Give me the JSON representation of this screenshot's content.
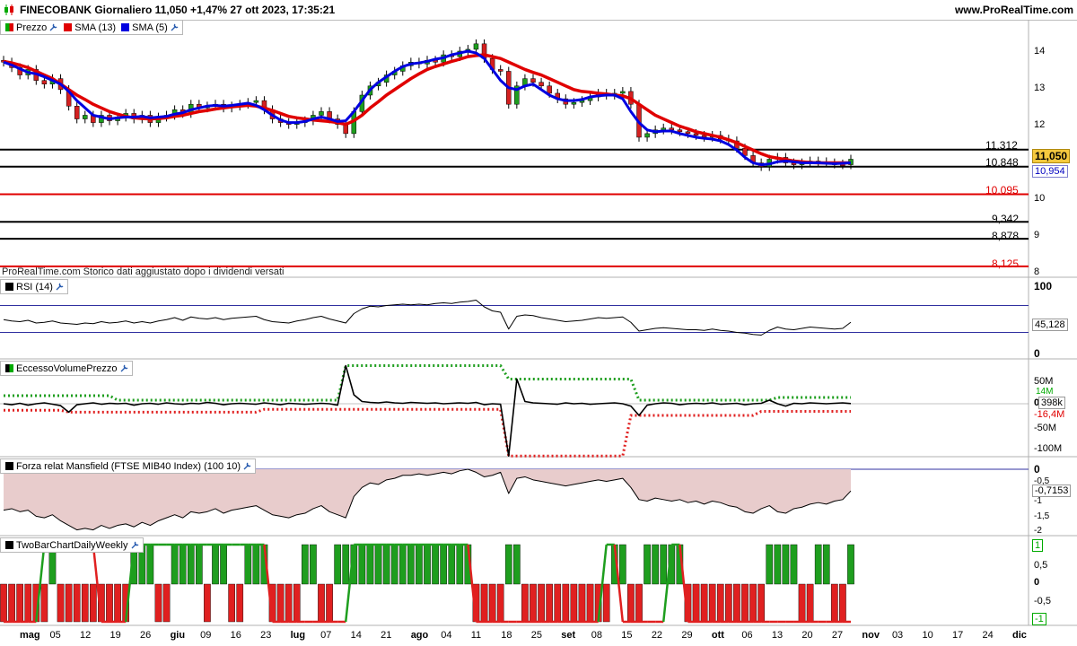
{
  "header": {
    "logo_icon": "candlestick-icon",
    "title": "FINECOBANK Giornaliero 11,050 +1,47% 27 ott 2023, 17:35:21",
    "site": "www.ProRealTime.com"
  },
  "price_panel": {
    "legend": {
      "label": "Prezzo",
      "icon": "wrench-icon"
    },
    "sma13": {
      "label": "SMA (13)",
      "color": "#e00000"
    },
    "sma5": {
      "label": "SMA (5)",
      "color": "#0000e0"
    },
    "note": "ProRealTime.com  Storico dati aggiustato dopo i dividendi versati",
    "y_ticks": [
      "14",
      "13",
      "12",
      "10",
      "9",
      "8"
    ],
    "levels": [
      {
        "value": "11,312",
        "color": "#000000"
      },
      {
        "value": "10,848",
        "color": "#000000"
      },
      {
        "value": "10,095",
        "color": "#e00000"
      },
      {
        "value": "9,342",
        "color": "#000000"
      },
      {
        "value": "8,878",
        "color": "#000000"
      },
      {
        "value": "8,125",
        "color": "#e00000"
      }
    ],
    "last_price": "11,050",
    "sma_badge": "10,954"
  },
  "rsi_panel": {
    "legend": "RSI (14)",
    "y_ticks": [
      "100",
      "0"
    ],
    "value": "45,128"
  },
  "volume_panel": {
    "legend": "EccessoVolumePrezzo",
    "y_ticks": [
      "50M",
      "0",
      "-50M",
      "-100M"
    ],
    "badge_upper": "14M",
    "badge_value": "398k",
    "badge_lower": "-16,4M"
  },
  "mansfield_panel": {
    "legend": "Forza relat Mansfield (FTSE MIB40 Index) (100 10)",
    "y_ticks": [
      "0",
      "-0,5",
      "-1",
      "-1,5",
      "-2"
    ],
    "value": "-0,7153"
  },
  "twobar_panel": {
    "legend": "TwoBarChartDailyWeekly",
    "y_ticks": [
      "0,5",
      "0",
      "-0,5"
    ],
    "badge_top": "1",
    "badge_bottom": "-1"
  },
  "x_axis": {
    "labels": [
      {
        "text": "mag",
        "bold": true
      },
      {
        "text": "05"
      },
      {
        "text": "12"
      },
      {
        "text": "19"
      },
      {
        "text": "26"
      },
      {
        "text": "giu",
        "bold": true
      },
      {
        "text": "09"
      },
      {
        "text": "16"
      },
      {
        "text": "23"
      },
      {
        "text": "lug",
        "bold": true
      },
      {
        "text": "07"
      },
      {
        "text": "14"
      },
      {
        "text": "21"
      },
      {
        "text": "ago",
        "bold": true
      },
      {
        "text": "04"
      },
      {
        "text": "11"
      },
      {
        "text": "18"
      },
      {
        "text": "25"
      },
      {
        "text": "set",
        "bold": true
      },
      {
        "text": "08"
      },
      {
        "text": "15"
      },
      {
        "text": "22"
      },
      {
        "text": "29"
      },
      {
        "text": "ott",
        "bold": true
      },
      {
        "text": "06"
      },
      {
        "text": "13"
      },
      {
        "text": "20"
      },
      {
        "text": "27"
      },
      {
        "text": "nov",
        "bold": true
      },
      {
        "text": "03"
      },
      {
        "text": "10"
      },
      {
        "text": "17"
      },
      {
        "text": "24"
      },
      {
        "text": "dic",
        "bold": true
      }
    ]
  },
  "chart_data": {
    "type": "line",
    "title": "FINECOBANK Giornaliero 11,050 +1,47% 27 ott 2023, 17:35:21",
    "x_range": [
      "2023-05-01",
      "2023-12-01"
    ],
    "price": {
      "ylim": [
        8,
        14.5
      ],
      "close": [
        13.7,
        13.55,
        13.35,
        13.5,
        13.2,
        13.1,
        13.25,
        12.95,
        12.5,
        12.15,
        12.25,
        12.05,
        12.25,
        12.1,
        12.2,
        12.3,
        12.15,
        12.25,
        12.05,
        12.2,
        12.25,
        12.4,
        12.3,
        12.55,
        12.45,
        12.5,
        12.55,
        12.45,
        12.5,
        12.55,
        12.6,
        12.65,
        12.4,
        12.15,
        12.05,
        12.0,
        12.05,
        12.1,
        12.25,
        12.35,
        12.15,
        12.0,
        11.75,
        12.35,
        12.8,
        13.05,
        13.15,
        13.35,
        13.45,
        13.6,
        13.7,
        13.65,
        13.75,
        13.7,
        13.9,
        13.85,
        14.0,
        14.05,
        14.2,
        13.8,
        13.5,
        13.45,
        12.55,
        13.05,
        13.25,
        13.15,
        13.05,
        12.85,
        12.7,
        12.55,
        12.6,
        12.65,
        12.75,
        12.85,
        12.8,
        12.85,
        12.9,
        12.55,
        11.65,
        11.75,
        11.85,
        11.9,
        11.85,
        11.8,
        11.75,
        11.7,
        11.65,
        11.7,
        11.6,
        11.55,
        11.35,
        11.15,
        10.95,
        10.85,
        11.05,
        11.1,
        10.95,
        10.9,
        10.95,
        11.0,
        10.98,
        10.95,
        10.92,
        10.9,
        11.05
      ],
      "sma13": [
        13.72,
        13.68,
        13.62,
        13.55,
        13.45,
        13.35,
        13.25,
        13.1,
        12.95,
        12.8,
        12.68,
        12.55,
        12.45,
        12.35,
        12.28,
        12.22,
        12.18,
        12.16,
        12.15,
        12.16,
        12.18,
        12.22,
        12.25,
        12.3,
        12.35,
        12.38,
        12.42,
        12.45,
        12.48,
        12.5,
        12.52,
        12.5,
        12.45,
        12.38,
        12.3,
        12.22,
        12.18,
        12.15,
        12.12,
        12.1,
        12.08,
        12.05,
        12.0,
        12.1,
        12.25,
        12.45,
        12.62,
        12.8,
        12.95,
        13.1,
        13.25,
        13.38,
        13.5,
        13.58,
        13.65,
        13.72,
        13.78,
        13.85,
        13.88,
        13.9,
        13.85,
        13.8,
        13.7,
        13.6,
        13.5,
        13.42,
        13.35,
        13.25,
        13.15,
        13.05,
        12.95,
        12.9,
        12.88,
        12.85,
        12.83,
        12.8,
        12.78,
        12.7,
        12.55,
        12.4,
        12.25,
        12.15,
        12.05,
        11.95,
        11.88,
        11.8,
        11.75,
        11.7,
        11.65,
        11.58,
        11.5,
        11.4,
        11.3,
        11.2,
        11.12,
        11.08,
        11.04,
        11.0,
        10.98,
        10.96,
        10.95,
        10.95,
        10.95,
        10.95,
        10.95
      ],
      "sma5": [
        13.7,
        13.62,
        13.52,
        13.42,
        13.38,
        13.3,
        13.2,
        13.1,
        12.9,
        12.65,
        12.45,
        12.25,
        12.2,
        12.15,
        12.18,
        12.2,
        12.2,
        12.22,
        12.18,
        12.2,
        12.22,
        12.28,
        12.32,
        12.4,
        12.45,
        12.5,
        12.52,
        12.5,
        12.52,
        12.55,
        12.58,
        12.52,
        12.4,
        12.25,
        12.12,
        12.05,
        12.05,
        12.08,
        12.15,
        12.2,
        12.15,
        12.08,
        12.1,
        12.35,
        12.65,
        12.95,
        13.15,
        13.3,
        13.45,
        13.58,
        13.65,
        13.68,
        13.72,
        13.78,
        13.82,
        13.9,
        13.95,
        14.0,
        13.95,
        13.8,
        13.5,
        13.2,
        13.0,
        12.95,
        13.05,
        13.1,
        12.95,
        12.8,
        12.7,
        12.65,
        12.65,
        12.68,
        12.75,
        12.78,
        12.8,
        12.8,
        12.7,
        12.35,
        12.05,
        11.85,
        11.8,
        11.82,
        11.82,
        11.75,
        11.7,
        11.65,
        11.62,
        11.6,
        11.55,
        11.45,
        11.3,
        11.1,
        10.95,
        10.9,
        10.92,
        10.98,
        11.0,
        10.98,
        10.95,
        10.95,
        10.95,
        10.94,
        10.93,
        10.94,
        10.954
      ],
      "levels": [
        11.312,
        10.848,
        10.095,
        9.342,
        8.878,
        8.125
      ]
    },
    "rsi": {
      "ylim": [
        0,
        100
      ],
      "bands": [
        70,
        30
      ],
      "values": [
        49,
        47,
        46,
        48,
        44,
        45,
        47,
        44,
        43,
        42,
        44,
        43,
        46,
        44,
        45,
        47,
        44,
        46,
        44,
        47,
        49,
        52,
        48,
        53,
        51,
        50,
        52,
        49,
        51,
        52,
        53,
        54,
        49,
        46,
        45,
        44,
        47,
        49,
        52,
        54,
        50,
        47,
        44,
        58,
        65,
        69,
        68,
        70,
        71,
        72,
        71,
        72,
        71,
        73,
        74,
        73,
        75,
        76,
        78,
        68,
        62,
        60,
        35,
        54,
        56,
        55,
        52,
        50,
        48,
        46,
        47,
        48,
        50,
        52,
        51,
        52,
        53,
        45,
        32,
        34,
        36,
        37,
        36,
        35,
        34,
        34,
        33,
        35,
        33,
        32,
        30,
        29,
        27,
        26,
        33,
        38,
        35,
        34,
        36,
        38,
        37,
        36,
        35,
        36,
        45.128
      ]
    },
    "volume_excess": {
      "ylim": [
        -110,
        60
      ],
      "unit": "M",
      "values": [
        0,
        -2,
        1,
        -3,
        0,
        2,
        -1,
        -4,
        -18,
        -2,
        0,
        2,
        -1,
        1,
        0,
        1,
        -3,
        0,
        1,
        -1,
        2,
        0,
        -1,
        1,
        0,
        3,
        1,
        -2,
        0,
        1,
        0,
        -1,
        2,
        0,
        -2,
        1,
        0,
        -1,
        0,
        1,
        0,
        -3,
        85,
        20,
        5,
        3,
        2,
        4,
        2,
        1,
        3,
        2,
        1,
        2,
        0,
        1,
        2,
        1,
        3,
        -2,
        0,
        -1,
        -112,
        55,
        5,
        2,
        1,
        0,
        -1,
        2,
        0,
        1,
        -1,
        0,
        1,
        2,
        0,
        -5,
        -25,
        -3,
        0,
        2,
        1,
        -2,
        0,
        1,
        0,
        2,
        -1,
        0,
        1,
        -2,
        0,
        1,
        8,
        0,
        -5,
        1,
        0,
        2,
        1,
        0,
        1,
        2,
        0.398
      ],
      "upper_band": [
        18,
        18,
        18,
        18,
        18,
        18,
        18,
        18,
        18,
        18,
        18,
        18,
        18,
        18,
        8,
        8,
        8,
        8,
        8,
        8,
        8,
        8,
        8,
        8,
        8,
        8,
        8,
        8,
        8,
        8,
        8,
        8,
        8,
        8,
        8,
        8,
        8,
        8,
        8,
        8,
        8,
        8,
        85,
        85,
        85,
        85,
        85,
        85,
        85,
        85,
        85,
        85,
        85,
        85,
        85,
        85,
        85,
        85,
        85,
        85,
        85,
        85,
        55,
        55,
        55,
        55,
        55,
        55,
        55,
        55,
        55,
        55,
        55,
        55,
        55,
        55,
        55,
        55,
        8,
        8,
        8,
        8,
        8,
        8,
        8,
        8,
        8,
        8,
        8,
        8,
        8,
        8,
        8,
        8,
        8,
        14,
        14,
        14,
        14,
        14,
        14,
        14,
        14,
        14,
        14
      ],
      "lower_band": [
        -14,
        -14,
        -14,
        -14,
        -14,
        -14,
        -14,
        -14,
        -18,
        -18,
        -18,
        -18,
        -18,
        -18,
        -18,
        -18,
        -18,
        -18,
        -18,
        -18,
        -18,
        -18,
        -18,
        -18,
        -18,
        -18,
        -18,
        -18,
        -18,
        -18,
        -18,
        -18,
        -12,
        -12,
        -12,
        -12,
        -12,
        -12,
        -12,
        -12,
        -12,
        -12,
        -12,
        -12,
        -12,
        -12,
        -12,
        -12,
        -12,
        -12,
        -12,
        -12,
        -12,
        -12,
        -12,
        -12,
        -12,
        -12,
        -12,
        -12,
        -12,
        -12,
        -112,
        -112,
        -112,
        -112,
        -112,
        -112,
        -112,
        -112,
        -112,
        -112,
        -112,
        -112,
        -112,
        -112,
        -112,
        -25,
        -25,
        -25,
        -25,
        -25,
        -25,
        -25,
        -25,
        -25,
        -25,
        -25,
        -25,
        -25,
        -25,
        -25,
        -25,
        -16.4,
        -16.4,
        -16.4,
        -16.4,
        -16.4,
        -16.4,
        -16.4,
        -16.4,
        -16.4,
        -16.4,
        -16.4,
        -16.4
      ]
    },
    "mansfield": {
      "ylim": [
        -2.2,
        0.1
      ],
      "values": [
        -1.35,
        -1.3,
        -1.4,
        -1.35,
        -1.55,
        -1.6,
        -1.5,
        -1.7,
        -1.85,
        -2.0,
        -1.95,
        -2.0,
        -1.85,
        -1.95,
        -1.85,
        -1.8,
        -1.9,
        -1.75,
        -1.85,
        -1.7,
        -1.6,
        -1.5,
        -1.6,
        -1.4,
        -1.45,
        -1.4,
        -1.3,
        -1.45,
        -1.35,
        -1.3,
        -1.25,
        -1.2,
        -1.35,
        -1.5,
        -1.55,
        -1.6,
        -1.5,
        -1.45,
        -1.3,
        -1.2,
        -1.4,
        -1.5,
        -1.6,
        -0.9,
        -0.6,
        -0.45,
        -0.5,
        -0.35,
        -0.3,
        -0.2,
        -0.2,
        -0.15,
        -0.2,
        -0.15,
        -0.1,
        -0.15,
        -0.05,
        0,
        -0.1,
        -0.25,
        -0.2,
        -0.1,
        -0.8,
        -0.3,
        -0.25,
        -0.35,
        -0.4,
        -0.45,
        -0.5,
        -0.55,
        -0.5,
        -0.45,
        -0.4,
        -0.35,
        -0.4,
        -0.35,
        -0.3,
        -0.6,
        -1.0,
        -1.05,
        -0.95,
        -1.0,
        -1.05,
        -1.0,
        -1.1,
        -1.05,
        -1.15,
        -1.05,
        -1.1,
        -1.2,
        -1.25,
        -1.4,
        -1.45,
        -1.3,
        -1.2,
        -1.4,
        -1.45,
        -1.3,
        -1.25,
        -1.15,
        -1.1,
        -1.15,
        -1.05,
        -1.0,
        -0.7153
      ]
    },
    "twobar": {
      "ylim": [
        -1,
        1
      ],
      "values": [
        -1,
        -1,
        -1,
        -1,
        -1,
        -1,
        1,
        -1,
        -1,
        -1,
        -1,
        -1,
        -1,
        -1,
        -1,
        -1,
        1,
        1,
        1,
        -1,
        -1,
        1,
        1,
        1,
        1,
        -1,
        1,
        1,
        -1,
        -1,
        1,
        1,
        1,
        -1,
        -1,
        -1,
        -1,
        1,
        1,
        -1,
        -1,
        1,
        1,
        1,
        1,
        1,
        1,
        1,
        1,
        1,
        1,
        1,
        1,
        1,
        1,
        1,
        1,
        1,
        -1,
        -1,
        -1,
        -1,
        1,
        1,
        -1,
        -1,
        -1,
        -1,
        -1,
        -1,
        -1,
        -1,
        -1,
        -1,
        -1,
        1,
        1,
        -1,
        -1,
        1,
        1,
        1,
        1,
        1,
        -1,
        -1,
        -1,
        -1,
        -1,
        -1,
        -1,
        -1,
        -1,
        -1,
        1,
        1,
        1,
        1,
        -1,
        -1,
        1,
        1,
        -1,
        -1,
        1
      ],
      "step_line": [
        -1,
        -1,
        -1,
        -1,
        -1,
        1,
        1,
        1,
        1,
        1,
        1,
        1,
        -1,
        -1,
        -1,
        -1,
        1,
        1,
        1,
        1,
        1,
        1,
        1,
        1,
        1,
        1,
        1,
        1,
        1,
        1,
        1,
        1,
        1,
        -1,
        -1,
        -1,
        -1,
        -1,
        -1,
        -1,
        -1,
        -1,
        -1,
        1,
        1,
        1,
        1,
        1,
        1,
        1,
        1,
        1,
        1,
        1,
        1,
        1,
        1,
        1,
        -1,
        -1,
        -1,
        -1,
        -1,
        -1,
        -1,
        -1,
        -1,
        -1,
        -1,
        -1,
        -1,
        -1,
        -1,
        -1,
        1,
        1,
        -1,
        -1,
        -1,
        -1,
        -1,
        -1,
        1,
        1,
        -1,
        -1,
        -1,
        -1,
        -1,
        -1,
        -1,
        -1,
        -1,
        -1,
        -1,
        -1,
        -1,
        -1,
        -1,
        -1,
        -1,
        -1,
        -1,
        -1,
        -1
      ]
    }
  }
}
